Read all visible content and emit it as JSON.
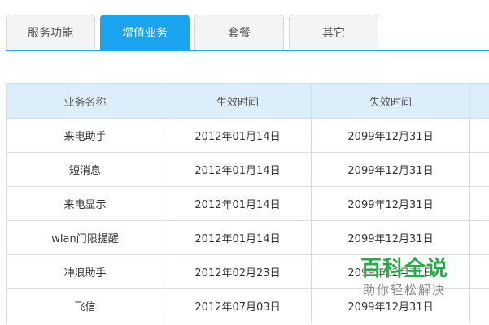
{
  "tabs": [
    {
      "label": "服务功能",
      "active": false
    },
    {
      "label": "增值业务",
      "active": true
    },
    {
      "label": "套餐",
      "active": false
    },
    {
      "label": "其它",
      "active": false
    }
  ],
  "table": {
    "headers": [
      "业务名称",
      "生效时间",
      "失效时间"
    ],
    "rows": [
      [
        "来电助手",
        "2012年01月14日",
        "2099年12月31日"
      ],
      [
        "短消息",
        "2012年01月14日",
        "2099年12月31日"
      ],
      [
        "来电显示",
        "2012年01月14日",
        "2099年12月31日"
      ],
      [
        "wlan门限提醒",
        "2012年01月14日",
        "2099年12月31日"
      ],
      [
        "冲浪助手",
        "2012年02月23日",
        "2099年12月31日"
      ],
      [
        "飞信",
        "2012年07月03日",
        "2099年12月31日"
      ]
    ]
  },
  "watermark": {
    "title": "百科全说",
    "subtitle": "助你轻松解决"
  },
  "colors": {
    "accent": "#1aa3ef",
    "header_bg": "#ddeefb",
    "watermark": "#2aa84a"
  }
}
